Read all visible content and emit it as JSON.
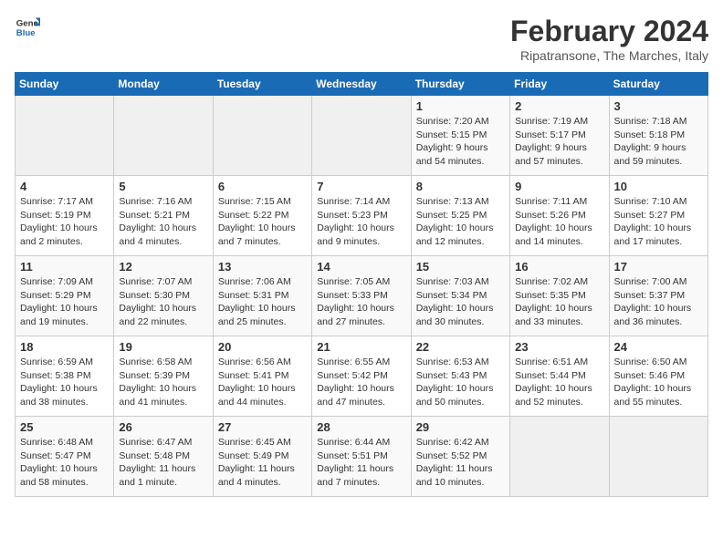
{
  "header": {
    "logo_line1": "General",
    "logo_line2": "Blue",
    "month": "February 2024",
    "location": "Ripatransone, The Marches, Italy"
  },
  "weekdays": [
    "Sunday",
    "Monday",
    "Tuesday",
    "Wednesday",
    "Thursday",
    "Friday",
    "Saturday"
  ],
  "weeks": [
    [
      {
        "day": "",
        "info": ""
      },
      {
        "day": "",
        "info": ""
      },
      {
        "day": "",
        "info": ""
      },
      {
        "day": "",
        "info": ""
      },
      {
        "day": "1",
        "info": "Sunrise: 7:20 AM\nSunset: 5:15 PM\nDaylight: 9 hours\nand 54 minutes."
      },
      {
        "day": "2",
        "info": "Sunrise: 7:19 AM\nSunset: 5:17 PM\nDaylight: 9 hours\nand 57 minutes."
      },
      {
        "day": "3",
        "info": "Sunrise: 7:18 AM\nSunset: 5:18 PM\nDaylight: 9 hours\nand 59 minutes."
      }
    ],
    [
      {
        "day": "4",
        "info": "Sunrise: 7:17 AM\nSunset: 5:19 PM\nDaylight: 10 hours\nand 2 minutes."
      },
      {
        "day": "5",
        "info": "Sunrise: 7:16 AM\nSunset: 5:21 PM\nDaylight: 10 hours\nand 4 minutes."
      },
      {
        "day": "6",
        "info": "Sunrise: 7:15 AM\nSunset: 5:22 PM\nDaylight: 10 hours\nand 7 minutes."
      },
      {
        "day": "7",
        "info": "Sunrise: 7:14 AM\nSunset: 5:23 PM\nDaylight: 10 hours\nand 9 minutes."
      },
      {
        "day": "8",
        "info": "Sunrise: 7:13 AM\nSunset: 5:25 PM\nDaylight: 10 hours\nand 12 minutes."
      },
      {
        "day": "9",
        "info": "Sunrise: 7:11 AM\nSunset: 5:26 PM\nDaylight: 10 hours\nand 14 minutes."
      },
      {
        "day": "10",
        "info": "Sunrise: 7:10 AM\nSunset: 5:27 PM\nDaylight: 10 hours\nand 17 minutes."
      }
    ],
    [
      {
        "day": "11",
        "info": "Sunrise: 7:09 AM\nSunset: 5:29 PM\nDaylight: 10 hours\nand 19 minutes."
      },
      {
        "day": "12",
        "info": "Sunrise: 7:07 AM\nSunset: 5:30 PM\nDaylight: 10 hours\nand 22 minutes."
      },
      {
        "day": "13",
        "info": "Sunrise: 7:06 AM\nSunset: 5:31 PM\nDaylight: 10 hours\nand 25 minutes."
      },
      {
        "day": "14",
        "info": "Sunrise: 7:05 AM\nSunset: 5:33 PM\nDaylight: 10 hours\nand 27 minutes."
      },
      {
        "day": "15",
        "info": "Sunrise: 7:03 AM\nSunset: 5:34 PM\nDaylight: 10 hours\nand 30 minutes."
      },
      {
        "day": "16",
        "info": "Sunrise: 7:02 AM\nSunset: 5:35 PM\nDaylight: 10 hours\nand 33 minutes."
      },
      {
        "day": "17",
        "info": "Sunrise: 7:00 AM\nSunset: 5:37 PM\nDaylight: 10 hours\nand 36 minutes."
      }
    ],
    [
      {
        "day": "18",
        "info": "Sunrise: 6:59 AM\nSunset: 5:38 PM\nDaylight: 10 hours\nand 38 minutes."
      },
      {
        "day": "19",
        "info": "Sunrise: 6:58 AM\nSunset: 5:39 PM\nDaylight: 10 hours\nand 41 minutes."
      },
      {
        "day": "20",
        "info": "Sunrise: 6:56 AM\nSunset: 5:41 PM\nDaylight: 10 hours\nand 44 minutes."
      },
      {
        "day": "21",
        "info": "Sunrise: 6:55 AM\nSunset: 5:42 PM\nDaylight: 10 hours\nand 47 minutes."
      },
      {
        "day": "22",
        "info": "Sunrise: 6:53 AM\nSunset: 5:43 PM\nDaylight: 10 hours\nand 50 minutes."
      },
      {
        "day": "23",
        "info": "Sunrise: 6:51 AM\nSunset: 5:44 PM\nDaylight: 10 hours\nand 52 minutes."
      },
      {
        "day": "24",
        "info": "Sunrise: 6:50 AM\nSunset: 5:46 PM\nDaylight: 10 hours\nand 55 minutes."
      }
    ],
    [
      {
        "day": "25",
        "info": "Sunrise: 6:48 AM\nSunset: 5:47 PM\nDaylight: 10 hours\nand 58 minutes."
      },
      {
        "day": "26",
        "info": "Sunrise: 6:47 AM\nSunset: 5:48 PM\nDaylight: 11 hours\nand 1 minute."
      },
      {
        "day": "27",
        "info": "Sunrise: 6:45 AM\nSunset: 5:49 PM\nDaylight: 11 hours\nand 4 minutes."
      },
      {
        "day": "28",
        "info": "Sunrise: 6:44 AM\nSunset: 5:51 PM\nDaylight: 11 hours\nand 7 minutes."
      },
      {
        "day": "29",
        "info": "Sunrise: 6:42 AM\nSunset: 5:52 PM\nDaylight: 11 hours\nand 10 minutes."
      },
      {
        "day": "",
        "info": ""
      },
      {
        "day": "",
        "info": ""
      }
    ]
  ]
}
